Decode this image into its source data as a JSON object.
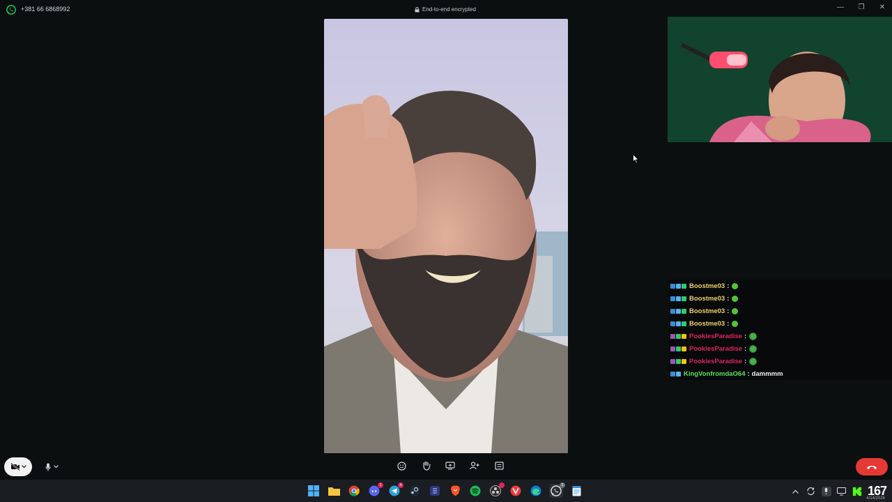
{
  "window": {
    "caller": "+381 66 6868992",
    "encryption_label": "End-to-end encrypted",
    "minimize": "—",
    "restore": "❐",
    "close": "✕"
  },
  "colors": {
    "whatsapp_green": "#25d366",
    "end_call_red": "#e53935",
    "twitch_blue": "#3a8fd6",
    "name_yellow": "#f2d26b",
    "name_red": "#e0245e",
    "name_green": "#5ce35c"
  },
  "chat": [
    {
      "user": "Boostme03",
      "separator": ":",
      "message": "",
      "emote": "small",
      "color": "#f2d26b",
      "badges": [
        "#3a8fd6",
        "#5ab0f0",
        "#2ecc71"
      ]
    },
    {
      "user": "Boostme03",
      "separator": ":",
      "message": "",
      "emote": "small",
      "color": "#f2d26b",
      "badges": [
        "#3a8fd6",
        "#5ab0f0",
        "#2ecc71"
      ]
    },
    {
      "user": "Boostme03",
      "separator": ":",
      "message": "",
      "emote": "small",
      "color": "#f2d26b",
      "badges": [
        "#3a8fd6",
        "#5ab0f0",
        "#2ecc71"
      ]
    },
    {
      "user": "Boostme03",
      "separator": ":",
      "message": "",
      "emote": "small",
      "color": "#f2d26b",
      "badges": [
        "#3a8fd6",
        "#5ab0f0",
        "#2ecc71"
      ]
    },
    {
      "user": "PookiesParadise",
      "separator": ":",
      "message": "",
      "emote": "big",
      "color": "#e0245e",
      "badges": [
        "#9b59b6",
        "#2ecc71",
        "#f1c40f"
      ]
    },
    {
      "user": "PookiesParadise",
      "separator": ":",
      "message": "",
      "emote": "big",
      "color": "#e0245e",
      "badges": [
        "#9b59b6",
        "#2ecc71",
        "#f1c40f"
      ]
    },
    {
      "user": "PookiesParadise",
      "separator": ":",
      "message": "",
      "emote": "big",
      "color": "#e0245e",
      "badges": [
        "#9b59b6",
        "#2ecc71",
        "#f1c40f"
      ]
    },
    {
      "user": "KingVonfromdaO64",
      "separator": ":",
      "message": "dammmm",
      "emote": "",
      "color": "#5ce35c",
      "badges": [
        "#3a8fd6",
        "#5ab0f0"
      ]
    }
  ],
  "controls": {
    "camera_icon": "video-off-icon",
    "mic_icon": "microphone-icon",
    "toolbar": [
      "emoji-icon",
      "raise-hand-icon",
      "share-screen-icon",
      "add-person-icon",
      "more-icon"
    ],
    "end_call_icon": "hang-up-icon"
  },
  "taskbar": {
    "apps": [
      "start",
      "file-explorer",
      "chrome",
      "discord",
      "telegram",
      "steam",
      "app",
      "brave",
      "spotify",
      "obs",
      "vivaldi",
      "edge",
      "whatsapp",
      "notepad"
    ],
    "discord_badge": "1",
    "telegram_badge": "4",
    "whatsapp_badge": "3",
    "viewer_count": "167",
    "date": "4/14/2026"
  }
}
